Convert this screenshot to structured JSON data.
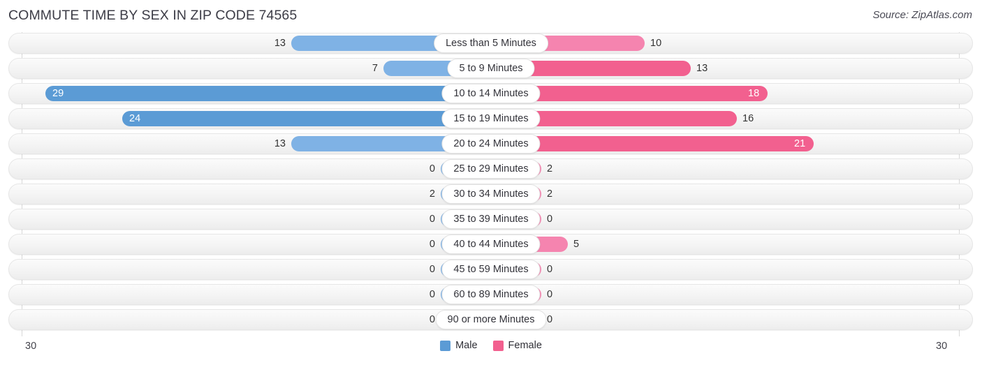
{
  "header": {
    "title": "COMMUTE TIME BY SEX IN ZIP CODE 74565",
    "source": "Source: ZipAtlas.com"
  },
  "axis": {
    "left_label": "30",
    "right_label": "30",
    "max": 30
  },
  "legend": {
    "items": [
      {
        "label": "Male",
        "color": "#5b9bd5"
      },
      {
        "label": "Female",
        "color": "#f2608f"
      }
    ]
  },
  "colors": {
    "male_light": "#7fb2e5",
    "male_strong": "#5b9bd5",
    "female_light": "#f584af",
    "female_strong": "#f2608f",
    "track": "#f4f4f4",
    "gridline": "#d8d8d8"
  },
  "chart_data": {
    "type": "bar",
    "orientation": "horizontal-diverging",
    "title": "COMMUTE TIME BY SEX IN ZIP CODE 74565",
    "xlabel": "",
    "ylabel": "",
    "xlim": [
      30,
      30
    ],
    "grid": true,
    "legend_position": "bottom-center",
    "categories": [
      "Less than 5 Minutes",
      "5 to 9 Minutes",
      "10 to 14 Minutes",
      "15 to 19 Minutes",
      "20 to 24 Minutes",
      "25 to 29 Minutes",
      "30 to 34 Minutes",
      "35 to 39 Minutes",
      "40 to 44 Minutes",
      "45 to 59 Minutes",
      "60 to 89 Minutes",
      "90 or more Minutes"
    ],
    "series": [
      {
        "name": "Male",
        "values": [
          13,
          7,
          29,
          24,
          13,
          0,
          2,
          0,
          0,
          0,
          0,
          0
        ]
      },
      {
        "name": "Female",
        "values": [
          10,
          13,
          18,
          16,
          21,
          2,
          2,
          0,
          5,
          0,
          0,
          0
        ]
      }
    ]
  },
  "rows": [
    {
      "category": "Less than 5 Minutes",
      "male": "13",
      "female": "10",
      "male_inside": false,
      "female_inside": false,
      "male_strong": false,
      "female_strong": false
    },
    {
      "category": "5 to 9 Minutes",
      "male": "7",
      "female": "13",
      "male_inside": false,
      "female_inside": false,
      "male_strong": false,
      "female_strong": true
    },
    {
      "category": "10 to 14 Minutes",
      "male": "29",
      "female": "18",
      "male_inside": true,
      "female_inside": true,
      "male_strong": true,
      "female_strong": true
    },
    {
      "category": "15 to 19 Minutes",
      "male": "24",
      "female": "16",
      "male_inside": true,
      "female_inside": false,
      "male_strong": true,
      "female_strong": true
    },
    {
      "category": "20 to 24 Minutes",
      "male": "13",
      "female": "21",
      "male_inside": false,
      "female_inside": true,
      "male_strong": false,
      "female_strong": true
    },
    {
      "category": "25 to 29 Minutes",
      "male": "0",
      "female": "2",
      "male_inside": false,
      "female_inside": false,
      "male_strong": false,
      "female_strong": false
    },
    {
      "category": "30 to 34 Minutes",
      "male": "2",
      "female": "2",
      "male_inside": false,
      "female_inside": false,
      "male_strong": false,
      "female_strong": false
    },
    {
      "category": "35 to 39 Minutes",
      "male": "0",
      "female": "0",
      "male_inside": false,
      "female_inside": false,
      "male_strong": false,
      "female_strong": false
    },
    {
      "category": "40 to 44 Minutes",
      "male": "0",
      "female": "5",
      "male_inside": false,
      "female_inside": false,
      "male_strong": false,
      "female_strong": false
    },
    {
      "category": "45 to 59 Minutes",
      "male": "0",
      "female": "0",
      "male_inside": false,
      "female_inside": false,
      "male_strong": false,
      "female_strong": false
    },
    {
      "category": "60 to 89 Minutes",
      "male": "0",
      "female": "0",
      "male_inside": false,
      "female_inside": false,
      "male_strong": false,
      "female_strong": false
    },
    {
      "category": "90 or more Minutes",
      "male": "0",
      "female": "0",
      "male_inside": false,
      "female_inside": false,
      "male_strong": false,
      "female_strong": false
    }
  ]
}
